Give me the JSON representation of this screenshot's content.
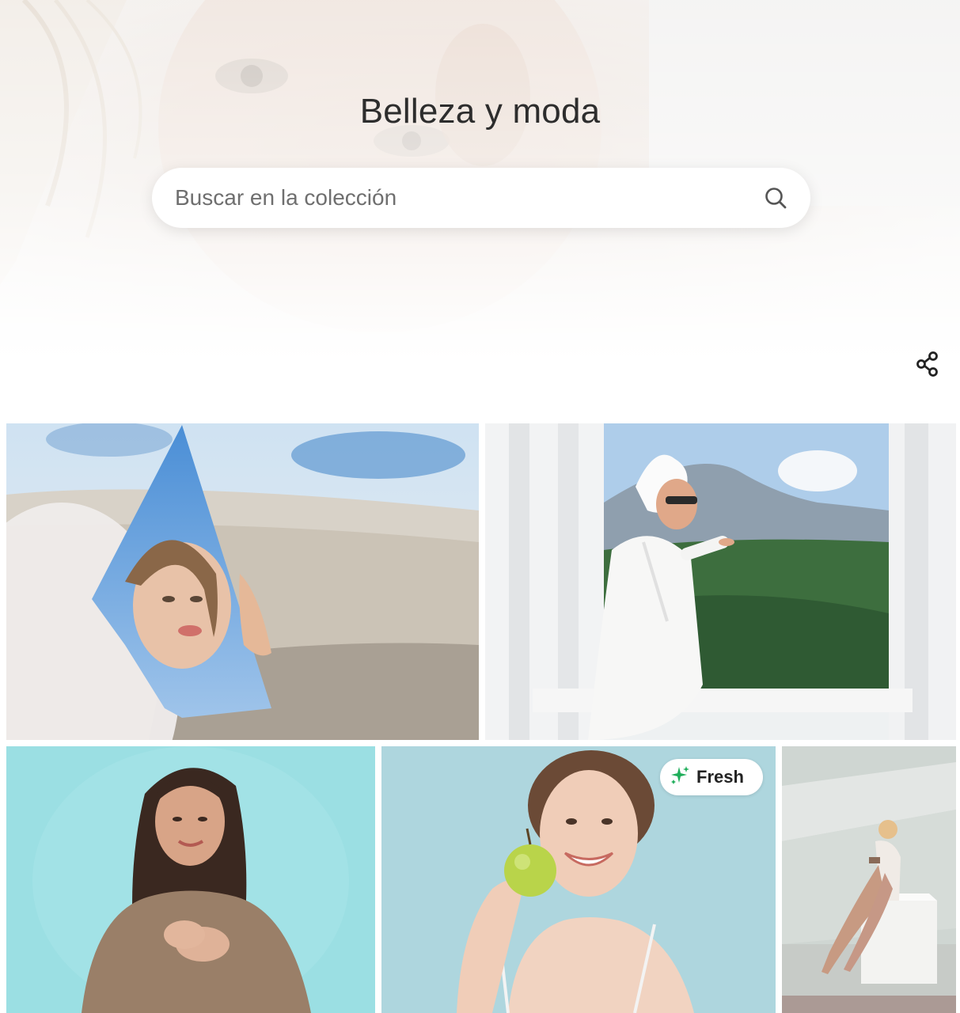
{
  "header": {
    "title": "Belleza y moda"
  },
  "search": {
    "placeholder": "Buscar en la colección",
    "icon": "search-icon"
  },
  "share": {
    "icon": "share-icon"
  },
  "gallery": {
    "photos": [
      {
        "subject": "woman-reflection-in-mirror-shard"
      },
      {
        "subject": "woman-in-bathrobe-and-towel-on-balcony"
      },
      {
        "subject": "woman-in-brown-sweater-hands-on-chest"
      },
      {
        "subject": "smiling-woman-holding-green-apple",
        "badge": "Fresh"
      },
      {
        "subject": "woman-posing-on-white-cube"
      }
    ],
    "badge": {
      "label": "Fresh",
      "icon": "sparkle-icon",
      "icon_color": "#1fae5a"
    }
  }
}
